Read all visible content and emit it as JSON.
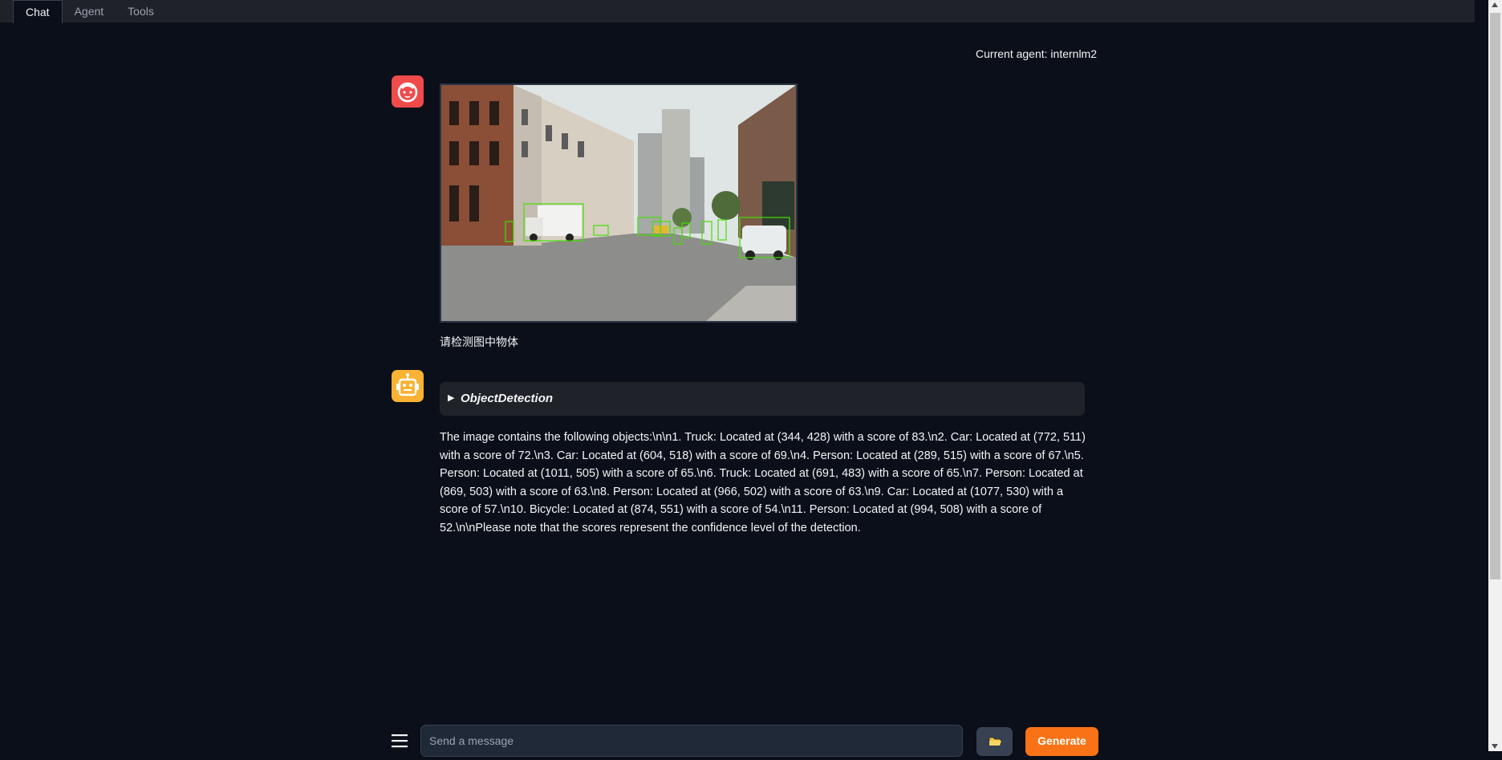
{
  "tabs": [
    {
      "label": "Chat",
      "active": true
    },
    {
      "label": "Agent",
      "active": false
    },
    {
      "label": "Tools",
      "active": false
    }
  ],
  "agent": {
    "label": "Current agent: internlm2"
  },
  "messages": {
    "user": {
      "avatar_icon": "baby-face-icon",
      "image_alt": "street scene with object detection boxes",
      "text": "请检测图中物体"
    },
    "bot": {
      "avatar_icon": "robot-icon",
      "tool_call": "ObjectDetection",
      "text": "The image contains the following objects:\\n\\n1. Truck: Located at (344, 428) with a score of 83.\\n2. Car: Located at (772, 511) with a score of 72.\\n3. Car: Located at (604, 518) with a score of 69.\\n4. Person: Located at (289, 515) with a score of 67.\\n5. Person: Located at (1011, 505) with a score of 65.\\n6. Truck: Located at (691, 483) with a score of 65.\\n7. Person: Located at (869, 503) with a score of 63.\\n8. Person: Located at (966, 502) with a score of 63.\\n9. Car: Located at (1077, 530) with a score of 57.\\n10. Bicycle: Located at (874, 551) with a score of 54.\\n11. Person: Located at (994, 508) with a score of 52.\\n\\nPlease note that the scores represent the confidence level of the detection."
    }
  },
  "composer": {
    "placeholder": "Send a message",
    "menu_icon": "hamburger-icon",
    "folder_icon": "folder-icon",
    "generate_label": "Generate"
  },
  "colors": {
    "background": "#0b0f19",
    "accent": "#f97316",
    "user_avatar": "#ef4b4b",
    "bot_avatar": "#f9b233"
  }
}
